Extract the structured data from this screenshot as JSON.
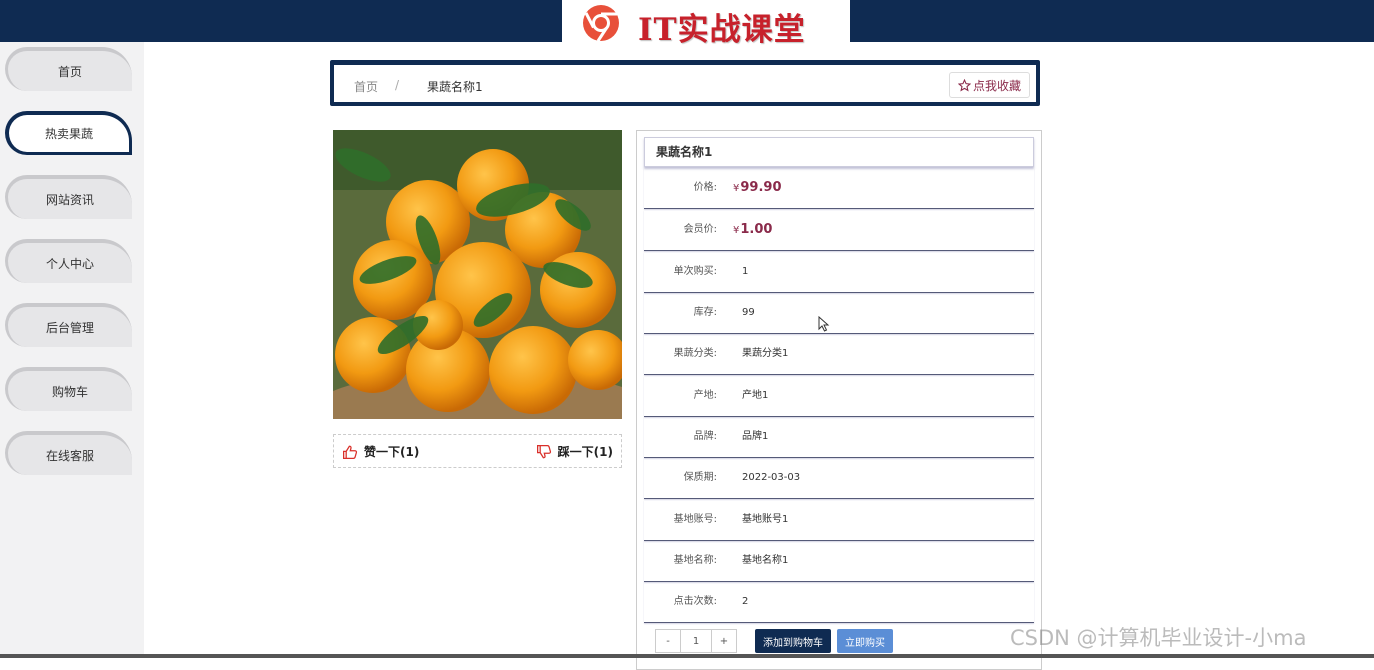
{
  "header": {
    "logo_text": "IT实战课堂",
    "brand_color": "#0f2b52",
    "logo_color": "#c7212b",
    "logo_icon": "chrome-like-logo-icon"
  },
  "sidebar": {
    "items": [
      {
        "label": "首页",
        "active": false
      },
      {
        "label": "热卖果蔬",
        "active": true
      },
      {
        "label": "网站资讯",
        "active": false
      },
      {
        "label": "个人中心",
        "active": false
      },
      {
        "label": "后台管理",
        "active": false
      },
      {
        "label": "购物车",
        "active": false
      },
      {
        "label": "在线客服",
        "active": false
      }
    ]
  },
  "breadcrumb": {
    "home": "首页",
    "separator": "/",
    "current": "果蔬名称1",
    "favorite_label": "点我收藏",
    "favorite_icon": "star-outline-icon"
  },
  "votes": {
    "like_label": "赞一下(1)",
    "like_icon": "thumbs-up-icon",
    "dislike_label": "踩一下(1)",
    "dislike_icon": "thumbs-down-icon"
  },
  "product": {
    "title": "果蔬名称1",
    "currency": "¥",
    "price_label": "价格:",
    "price": "99.90",
    "member_price_label": "会员价:",
    "member_price": "1.00",
    "fields": [
      {
        "label": "单次购买:",
        "value": "1"
      },
      {
        "label": "库存:",
        "value": "99"
      },
      {
        "label": "果蔬分类:",
        "value": "果蔬分类1"
      },
      {
        "label": "产地:",
        "value": "产地1"
      },
      {
        "label": "品牌:",
        "value": "品牌1"
      },
      {
        "label": "保质期:",
        "value": "2022-03-03"
      },
      {
        "label": "基地账号:",
        "value": "基地账号1"
      },
      {
        "label": "基地名称:",
        "value": "基地名称1"
      },
      {
        "label": "点击次数:",
        "value": "2"
      }
    ]
  },
  "actions": {
    "minus": "-",
    "quantity": "1",
    "plus": "+",
    "add_to_cart": "添加到购物车",
    "buy_now": "立即购买"
  },
  "watermark": "CSDN @计算机毕业设计-小ma"
}
